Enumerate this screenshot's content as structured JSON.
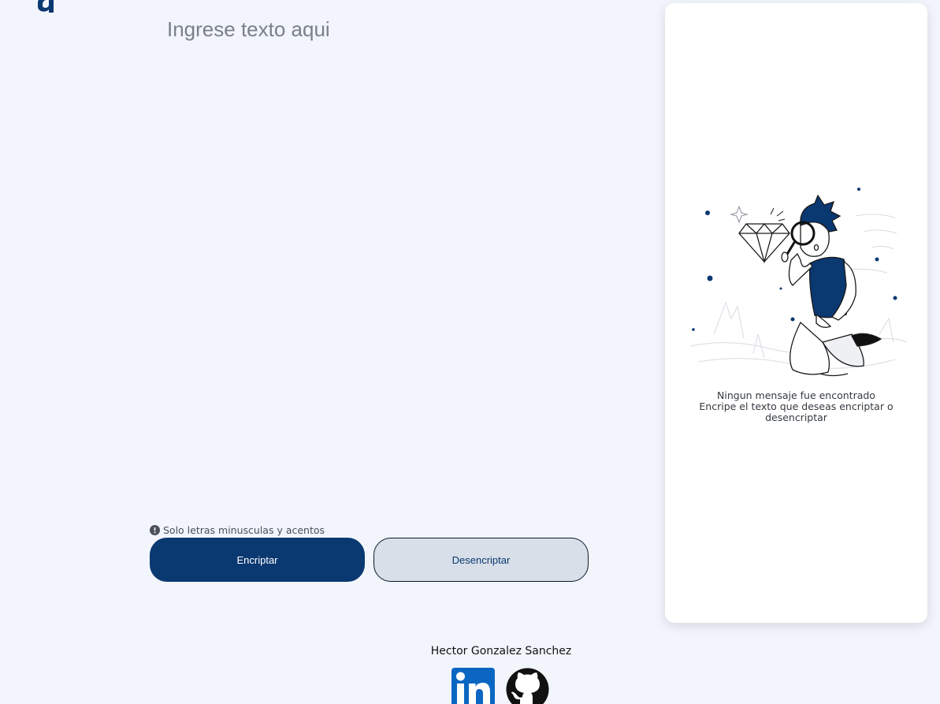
{
  "app": {
    "logo_icon": "alura-logo-icon"
  },
  "input": {
    "placeholder": "Ingrese texto aqui",
    "value": ""
  },
  "hint": {
    "icon": "info-circle-icon",
    "text": "Solo letras minusculas y acentos"
  },
  "buttons": {
    "encrypt_label": "Encriptar",
    "decrypt_label": "Desencriptar"
  },
  "result_panel": {
    "illustration": "person-with-magnifier-illustration",
    "title": "Ningun mensaje fue encontrado",
    "subtitle": "Encripe el texto que deseas encriptar o desencriptar"
  },
  "footer": {
    "author": "Hector Gonzalez Sanchez",
    "linkedin_icon": "linkedin-icon",
    "github_icon": "github-icon"
  },
  "colors": {
    "background": "#f2f5fc",
    "primary": "#0a3871",
    "secondary_button": "#d8dfe8",
    "panel": "#ffffff"
  }
}
